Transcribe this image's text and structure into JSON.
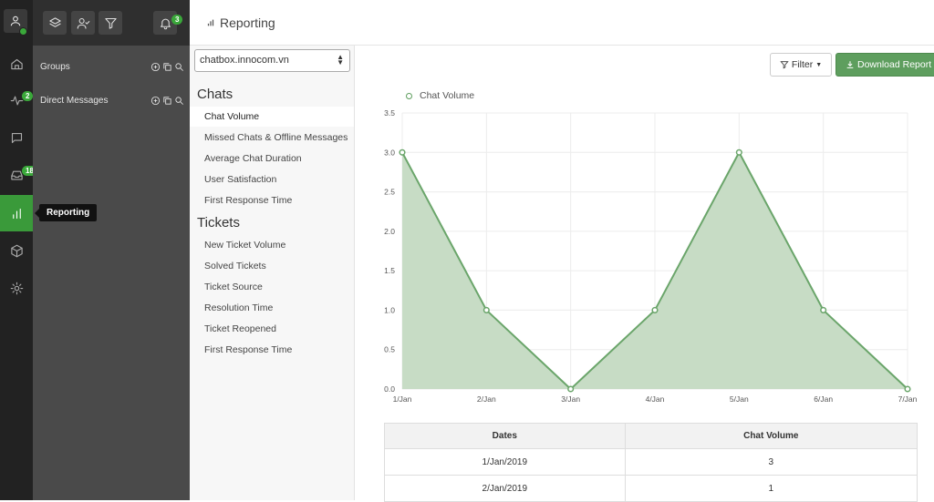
{
  "rail": {
    "notifications_count": "2",
    "inbox_count": "182",
    "tooltip": "Reporting"
  },
  "panel": {
    "bell_count": "3",
    "groups_label": "Groups",
    "dm_label": "Direct Messages"
  },
  "topbar": {
    "title": "Reporting"
  },
  "menu": {
    "site_select": "chatbox.innocom.vn",
    "chats_heading": "Chats",
    "chats": [
      "Chat Volume",
      "Missed Chats & Offline Messages",
      "Average Chat Duration",
      "User Satisfaction",
      "First Response Time"
    ],
    "tickets_heading": "Tickets",
    "tickets": [
      "New Ticket Volume",
      "Solved Tickets",
      "Ticket Source",
      "Resolution Time",
      "Ticket Reopened",
      "First Response Time"
    ]
  },
  "toolbar": {
    "filter_label": "Filter",
    "download_label": "Download Report"
  },
  "chart_data": {
    "type": "area",
    "x": [
      "1/Jan",
      "2/Jan",
      "3/Jan",
      "4/Jan",
      "5/Jan",
      "6/Jan",
      "7/Jan"
    ],
    "series": [
      {
        "name": "Chat Volume",
        "values": [
          3,
          1,
          0,
          1,
          3,
          1,
          0
        ]
      }
    ],
    "yticks": [
      "0.0",
      "0.5",
      "1.0",
      "1.5",
      "2.0",
      "2.5",
      "3.0",
      "3.5"
    ],
    "ylim": [
      0,
      3.5
    ],
    "grid": true,
    "legend": "top-left",
    "color": "#6aa56a",
    "fill": "#c7dcc5"
  },
  "table": {
    "headers": [
      "Dates",
      "Chat Volume"
    ],
    "rows": [
      [
        "1/Jan/2019",
        "3"
      ],
      [
        "2/Jan/2019",
        "1"
      ]
    ]
  }
}
